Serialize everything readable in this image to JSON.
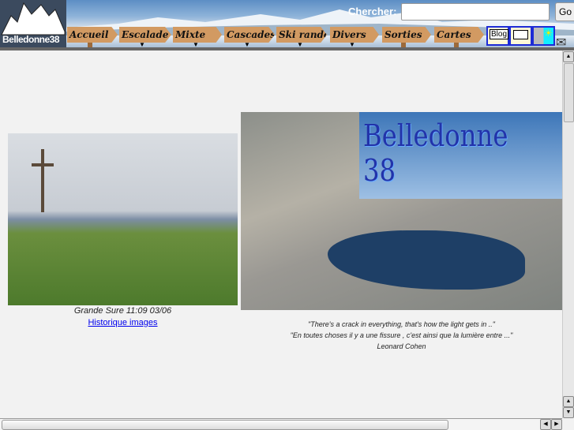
{
  "header": {
    "logo_text": "Belledonne38",
    "search_label": "Chercher:",
    "search_value": "",
    "go_label": "Go",
    "nav": [
      {
        "label": "Accueil",
        "dropdown": false
      },
      {
        "label": "Escalade",
        "dropdown": true
      },
      {
        "label": "Mixte",
        "dropdown": true
      },
      {
        "label": "Cascades",
        "dropdown": true
      },
      {
        "label": "Ski rando",
        "dropdown": true
      },
      {
        "label": "Divers",
        "dropdown": true
      },
      {
        "label": "Sorties",
        "dropdown": false
      },
      {
        "label": "Cartes",
        "dropdown": false
      }
    ],
    "icons": {
      "blog_label": "Blog",
      "screen": "presentation-board-icon",
      "weather": "weather-icon",
      "mail": "mail-icon"
    }
  },
  "main": {
    "left_caption": "Grande Sure 11:09 03/06",
    "history_link": "Historique images",
    "banner_text": "Belledonne 38",
    "quote_en": "\"There's a crack in everything, that's how the light gets in ..\"",
    "quote_fr": "\"En toutes choses il y a une fissure , c'est ainsi que la lumière entre ...\"",
    "quote_author": "Leonard Cohen"
  }
}
